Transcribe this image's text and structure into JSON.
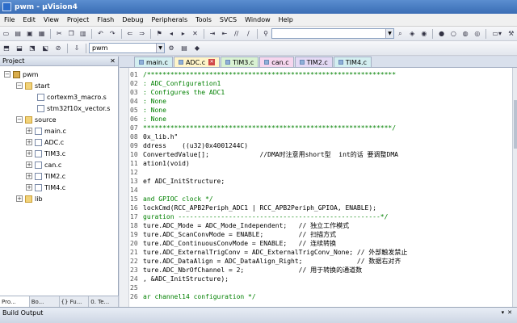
{
  "window": {
    "title": "pwm - µVision4"
  },
  "menu": [
    "File",
    "Edit",
    "View",
    "Project",
    "Flash",
    "Debug",
    "Peripherals",
    "Tools",
    "SVCS",
    "Window",
    "Help"
  ],
  "toolbar2": {
    "target": "pwm"
  },
  "project_panel": {
    "title": "Project",
    "tree": [
      {
        "label": "pwm",
        "level": 0,
        "type": "target",
        "expander": "−"
      },
      {
        "label": "start",
        "level": 1,
        "type": "folder",
        "expander": "−"
      },
      {
        "label": "cortexm3_macro.s",
        "level": 2,
        "type": "file",
        "expander": ""
      },
      {
        "label": "stm32f10x_vector.s",
        "level": 2,
        "type": "file",
        "expander": ""
      },
      {
        "label": "source",
        "level": 1,
        "type": "folder",
        "expander": "−"
      },
      {
        "label": "main.c",
        "level": 2,
        "type": "file",
        "expander": "+"
      },
      {
        "label": "ADC.c",
        "level": 2,
        "type": "file",
        "expander": "+"
      },
      {
        "label": "TIM3.c",
        "level": 2,
        "type": "file",
        "expander": "+"
      },
      {
        "label": "can.c",
        "level": 2,
        "type": "file",
        "expander": "+"
      },
      {
        "label": "TIM2.c",
        "level": 2,
        "type": "file",
        "expander": "+"
      },
      {
        "label": "TIM4.c",
        "level": 2,
        "type": "file",
        "expander": "+"
      },
      {
        "label": "lib",
        "level": 1,
        "type": "folder",
        "expander": "+"
      }
    ],
    "tabs": [
      "Pro...",
      "Bo...",
      "{} Fu...",
      "0. Te..."
    ]
  },
  "editor": {
    "tabs": [
      {
        "label": "main.c",
        "style": "c-teal",
        "active": false
      },
      {
        "label": "ADC.c",
        "style": "active",
        "active": true
      },
      {
        "label": "TIM3.c",
        "style": "c-green",
        "active": false
      },
      {
        "label": "can.c",
        "style": "c-pink",
        "active": false
      },
      {
        "label": "TIM2.c",
        "style": "c-purple",
        "active": false
      },
      {
        "label": "TIM4.c",
        "style": "c-teal",
        "active": false
      }
    ],
    "lines": [
      {
        "n": "01",
        "t": "/****************************************************************",
        "k": "comment"
      },
      {
        "n": "02",
        "t": ": ADC_Configuration1",
        "k": "comment"
      },
      {
        "n": "03",
        "t": ": Configures the ADC1",
        "k": "comment"
      },
      {
        "n": "04",
        "t": ": None",
        "k": "comment"
      },
      {
        "n": "05",
        "t": ": None",
        "k": "comment"
      },
      {
        "n": "06",
        "t": ": None",
        "k": "comment"
      },
      {
        "n": "07",
        "t": "****************************************************************/",
        "k": "comment"
      },
      {
        "n": "08",
        "t": "0x_lib.h\"",
        "k": "def"
      },
      {
        "n": "09",
        "t": "ddress    ((u32)0x4001244C)",
        "k": "def"
      },
      {
        "n": "10",
        "t": "ConvertedValue[];             //DMA时注意用short型  int的话 要调整DMA",
        "k": "def"
      },
      {
        "n": "11",
        "t": "ation1(void)",
        "k": "def"
      },
      {
        "n": "12",
        "t": "",
        "k": "def"
      },
      {
        "n": "13",
        "t": "ef ADC_InitStructure;",
        "k": "def"
      },
      {
        "n": "14",
        "t": "",
        "k": "def"
      },
      {
        "n": "15",
        "t": "and GPIOC clock */",
        "k": "comment"
      },
      {
        "n": "16",
        "t": "lockCmd(RCC_APB2Periph_ADC1 | RCC_APB2Periph_GPIOA, ENABLE);",
        "k": "def"
      },
      {
        "n": "17",
        "t": "guration ----------------------------------------------------*/",
        "k": "comment"
      },
      {
        "n": "18",
        "t": "ture.ADC_Mode = ADC_Mode_Independent;   // 独立工作模式",
        "k": "def"
      },
      {
        "n": "19",
        "t": "ture.ADC_ScanConvMode = ENABLE;         // 扫描方式",
        "k": "def"
      },
      {
        "n": "20",
        "t": "ture.ADC_ContinuousConvMode = ENABLE;   // 连续转换",
        "k": "def"
      },
      {
        "n": "21",
        "t": "ture.ADC_ExternalTrigConv = ADC_ExternalTrigConv_None; // 外部触发禁止",
        "k": "def"
      },
      {
        "n": "22",
        "t": "ture.ADC_DataAlign = ADC_DataAlign_Right;              // 数据右对齐",
        "k": "def"
      },
      {
        "n": "23",
        "t": "ture.ADC_NbrOfChannel = 2;              // 用于转换的通道数",
        "k": "def"
      },
      {
        "n": "24",
        "t": ", &ADC_InitStructure);",
        "k": "def"
      },
      {
        "n": "25",
        "t": "",
        "k": "def"
      },
      {
        "n": "26",
        "t": "ar channel14 configuration */",
        "k": "comment"
      }
    ]
  },
  "build_output": {
    "title": "Build Output"
  }
}
